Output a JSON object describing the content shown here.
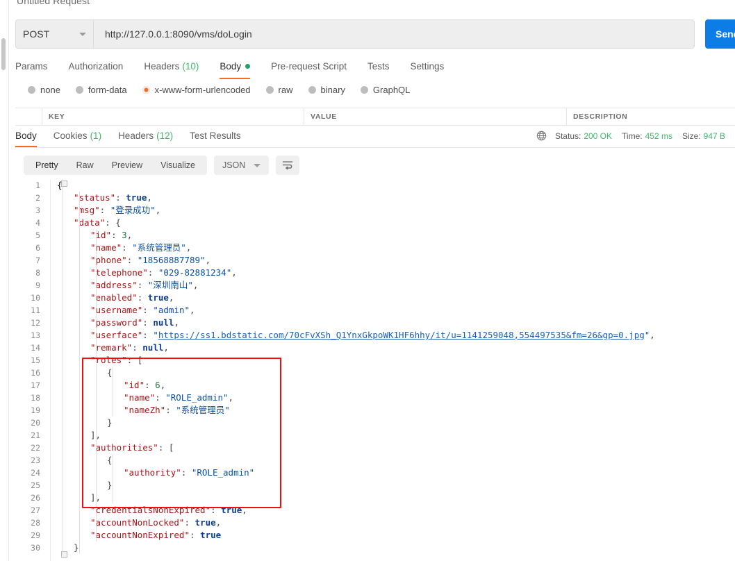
{
  "request": {
    "title": "Untitled Request",
    "method": "POST",
    "url": "http://127.0.0.1:8090/vms/doLogin",
    "send_label": "Send",
    "tabs": [
      {
        "label": "Params",
        "count": "",
        "active": false,
        "dot": false
      },
      {
        "label": "Authorization",
        "count": "",
        "active": false,
        "dot": false
      },
      {
        "label": "Headers",
        "count": "(10)",
        "active": false,
        "dot": false
      },
      {
        "label": "Body",
        "count": "",
        "active": true,
        "dot": true
      },
      {
        "label": "Pre-request Script",
        "count": "",
        "active": false,
        "dot": false
      },
      {
        "label": "Tests",
        "count": "",
        "active": false,
        "dot": false
      },
      {
        "label": "Settings",
        "count": "",
        "active": false,
        "dot": false
      }
    ],
    "body_types": [
      {
        "label": "none",
        "selected": false
      },
      {
        "label": "form-data",
        "selected": false
      },
      {
        "label": "x-www-form-urlencoded",
        "selected": true
      },
      {
        "label": "raw",
        "selected": false
      },
      {
        "label": "binary",
        "selected": false
      },
      {
        "label": "GraphQL",
        "selected": false
      }
    ],
    "table_headers": [
      "KEY",
      "VALUE",
      "DESCRIPTION"
    ]
  },
  "response": {
    "tabs": [
      {
        "label": "Body",
        "count": "",
        "active": true
      },
      {
        "label": "Cookies",
        "count": "(1)",
        "active": false
      },
      {
        "label": "Headers",
        "count": "(12)",
        "active": false
      },
      {
        "label": "Test Results",
        "count": "",
        "active": false
      }
    ],
    "status_label": "Status:",
    "status_value": "200 OK",
    "time_label": "Time:",
    "time_value": "452 ms",
    "size_label": "Size:",
    "size_value": "947 B",
    "formats": [
      {
        "label": "Pretty",
        "active": true
      },
      {
        "label": "Raw",
        "active": false
      },
      {
        "label": "Preview",
        "active": false
      },
      {
        "label": "Visualize",
        "active": false
      }
    ],
    "content_type": "JSON",
    "accent_color": "#f06c27",
    "success_color": "#3eb96a",
    "send_color": "#0c7ce6",
    "annotation_color": "#ef0f0f"
  },
  "body_json": {
    "status": true,
    "msg": "登录成功",
    "data": {
      "id": 3,
      "name": "系统管理员",
      "phone": "18568887789",
      "telephone": "029-82881234",
      "address": "深圳南山",
      "enabled": true,
      "username": "admin",
      "password": null,
      "userface": "https://ss1.bdstatic.com/70cFvXSh_Q1YnxGkpoWK1HF6hhy/it/u=1141259048,554497535&fm=26&gp=0.jpg",
      "remark": null,
      "roles": [
        {
          "id": 6,
          "name": "ROLE_admin",
          "nameZh": "系统管理员"
        }
      ],
      "authorities": [
        {
          "authority": "ROLE_admin"
        }
      ],
      "credentialsNonExpired": true,
      "accountNonLocked": true,
      "accountNonExpired": true
    }
  },
  "code_lines": [
    {
      "n": 1,
      "indent": 0,
      "html": "{"
    },
    {
      "n": 2,
      "indent": 1,
      "html": "<span class='k'>\"status\"</span><span class='p'>: </span><span class='b'>true</span><span class='p'>,</span>"
    },
    {
      "n": 3,
      "indent": 1,
      "html": "<span class='k'>\"msg\"</span><span class='p'>: </span><span class='s'>\"登录成功\"</span><span class='p'>,</span>"
    },
    {
      "n": 4,
      "indent": 1,
      "html": "<span class='k'>\"data\"</span><span class='p'>: {</span>"
    },
    {
      "n": 5,
      "indent": 2,
      "html": "<span class='k'>\"id\"</span><span class='p'>: </span><span class='n'>3</span><span class='p'>,</span>"
    },
    {
      "n": 6,
      "indent": 2,
      "html": "<span class='k'>\"name\"</span><span class='p'>: </span><span class='s'>\"系统管理员\"</span><span class='p'>,</span>"
    },
    {
      "n": 7,
      "indent": 2,
      "html": "<span class='k'>\"phone\"</span><span class='p'>: </span><span class='s'>\"18568887789\"</span><span class='p'>,</span>"
    },
    {
      "n": 8,
      "indent": 2,
      "html": "<span class='k'>\"telephone\"</span><span class='p'>: </span><span class='s'>\"029-82881234\"</span><span class='p'>,</span>"
    },
    {
      "n": 9,
      "indent": 2,
      "html": "<span class='k'>\"address\"</span><span class='p'>: </span><span class='s'>\"深圳南山\"</span><span class='p'>,</span>"
    },
    {
      "n": 10,
      "indent": 2,
      "html": "<span class='k'>\"enabled\"</span><span class='p'>: </span><span class='b'>true</span><span class='p'>,</span>"
    },
    {
      "n": 11,
      "indent": 2,
      "html": "<span class='k'>\"username\"</span><span class='p'>: </span><span class='s'>\"admin\"</span><span class='p'>,</span>"
    },
    {
      "n": 12,
      "indent": 2,
      "html": "<span class='k'>\"password\"</span><span class='p'>: </span><span class='b'>null</span><span class='p'>,</span>"
    },
    {
      "n": 13,
      "indent": 2,
      "html": "<span class='k'>\"userface\"</span><span class='p'>: </span><span class='s'>\"</span><span class='lnk'>https://ss1.bdstatic.com/70cFvXSh_Q1YnxGkpoWK1HF6hhy/it/u=1141259048,554497535&amp;fm=26&amp;gp=0.jpg</span><span class='s'>\"</span><span class='p'>,</span>"
    },
    {
      "n": 14,
      "indent": 2,
      "html": "<span class='k'>\"remark\"</span><span class='p'>: </span><span class='b'>null</span><span class='p'>,</span>"
    },
    {
      "n": 15,
      "indent": 2,
      "html": "<span class='k'>\"roles\"</span><span class='p'>: [</span>"
    },
    {
      "n": 16,
      "indent": 3,
      "html": "<span class='p'>{</span>"
    },
    {
      "n": 17,
      "indent": 4,
      "html": "<span class='k'>\"id\"</span><span class='p'>: </span><span class='n'>6</span><span class='p'>,</span>"
    },
    {
      "n": 18,
      "indent": 4,
      "html": "<span class='k'>\"name\"</span><span class='p'>: </span><span class='s'>\"ROLE_admin\"</span><span class='p'>,</span>"
    },
    {
      "n": 19,
      "indent": 4,
      "html": "<span class='k'>\"nameZh\"</span><span class='p'>: </span><span class='s'>\"系统管理员\"</span>"
    },
    {
      "n": 20,
      "indent": 3,
      "html": "<span class='p'>}</span>"
    },
    {
      "n": 21,
      "indent": 2,
      "html": "<span class='p'>],</span>"
    },
    {
      "n": 22,
      "indent": 2,
      "html": "<span class='k'>\"authorities\"</span><span class='p'>: [</span>"
    },
    {
      "n": 23,
      "indent": 3,
      "html": "<span class='p'>{</span>"
    },
    {
      "n": 24,
      "indent": 4,
      "html": "<span class='k'>\"authority\"</span><span class='p'>: </span><span class='s'>\"ROLE_admin\"</span>"
    },
    {
      "n": 25,
      "indent": 3,
      "html": "<span class='p'>}</span>"
    },
    {
      "n": 26,
      "indent": 2,
      "html": "<span class='p'>],</span>"
    },
    {
      "n": 27,
      "indent": 2,
      "html": "<span class='k'>\"credentialsNonExpired\"</span><span class='p'>: </span><span class='b'>true</span><span class='p'>,</span>"
    },
    {
      "n": 28,
      "indent": 2,
      "html": "<span class='k'>\"accountNonLocked\"</span><span class='p'>: </span><span class='b'>true</span><span class='p'>,</span>"
    },
    {
      "n": 29,
      "indent": 2,
      "html": "<span class='k'>\"accountNonExpired\"</span><span class='p'>: </span><span class='b'>true</span>"
    },
    {
      "n": 30,
      "indent": 1,
      "html": "<span class='p'>}</span>"
    }
  ]
}
